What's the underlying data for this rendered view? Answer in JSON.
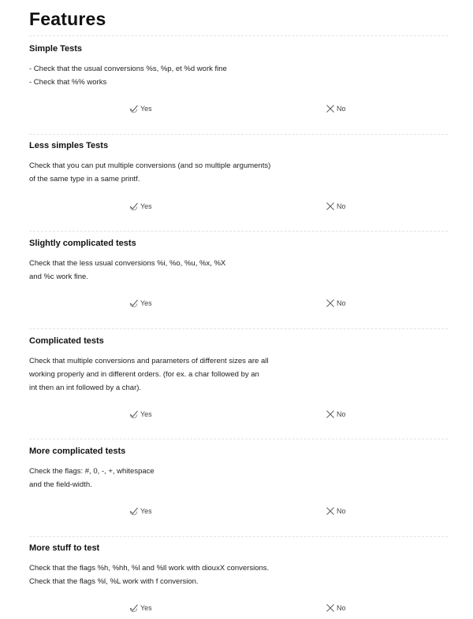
{
  "page": {
    "title": "Features"
  },
  "sections": [
    {
      "title": "Simple Tests",
      "lines": [
        "- Check that the usual conversions %s, %p, et %d work fine",
        "- Check that %% works"
      ],
      "yes_label": "Yes",
      "no_label": "No"
    },
    {
      "title": "Less simples Tests",
      "lines": [
        "Check that you can put multiple conversions (and so multiple arguments)",
        "of the same type in a same printf."
      ],
      "yes_label": "Yes",
      "no_label": "No"
    },
    {
      "title": "Slightly complicated tests",
      "lines": [
        "Check that the less usual conversions %i, %o, %u, %x, %X",
        "and %c work fine."
      ],
      "yes_label": "Yes",
      "no_label": "No"
    },
    {
      "title": "Complicated tests",
      "lines": [
        "Check that multiple conversions and parameters of different sizes are all",
        "working properly and in different orders. (for ex. a char followed by an",
        "int then an int followed by a char)."
      ],
      "yes_label": "Yes",
      "no_label": "No"
    },
    {
      "title": "More complicated tests",
      "lines": [
        "Check the flags: #, 0, -, +, whitespace",
        "and the field-width."
      ],
      "yes_label": "Yes",
      "no_label": "No"
    },
    {
      "title": "More stuff to test",
      "lines": [
        "Check that the flags %h, %hh, %l and %ll work with diouxX conversions.",
        "Check that the flags %l, %L work with f conversion."
      ],
      "yes_label": "Yes",
      "no_label": "No"
    }
  ],
  "icons": {
    "yes": "check-icon",
    "no": "cross-icon"
  },
  "colors": {
    "icon_stroke": "#555555",
    "divider": "#e3e3e3"
  }
}
